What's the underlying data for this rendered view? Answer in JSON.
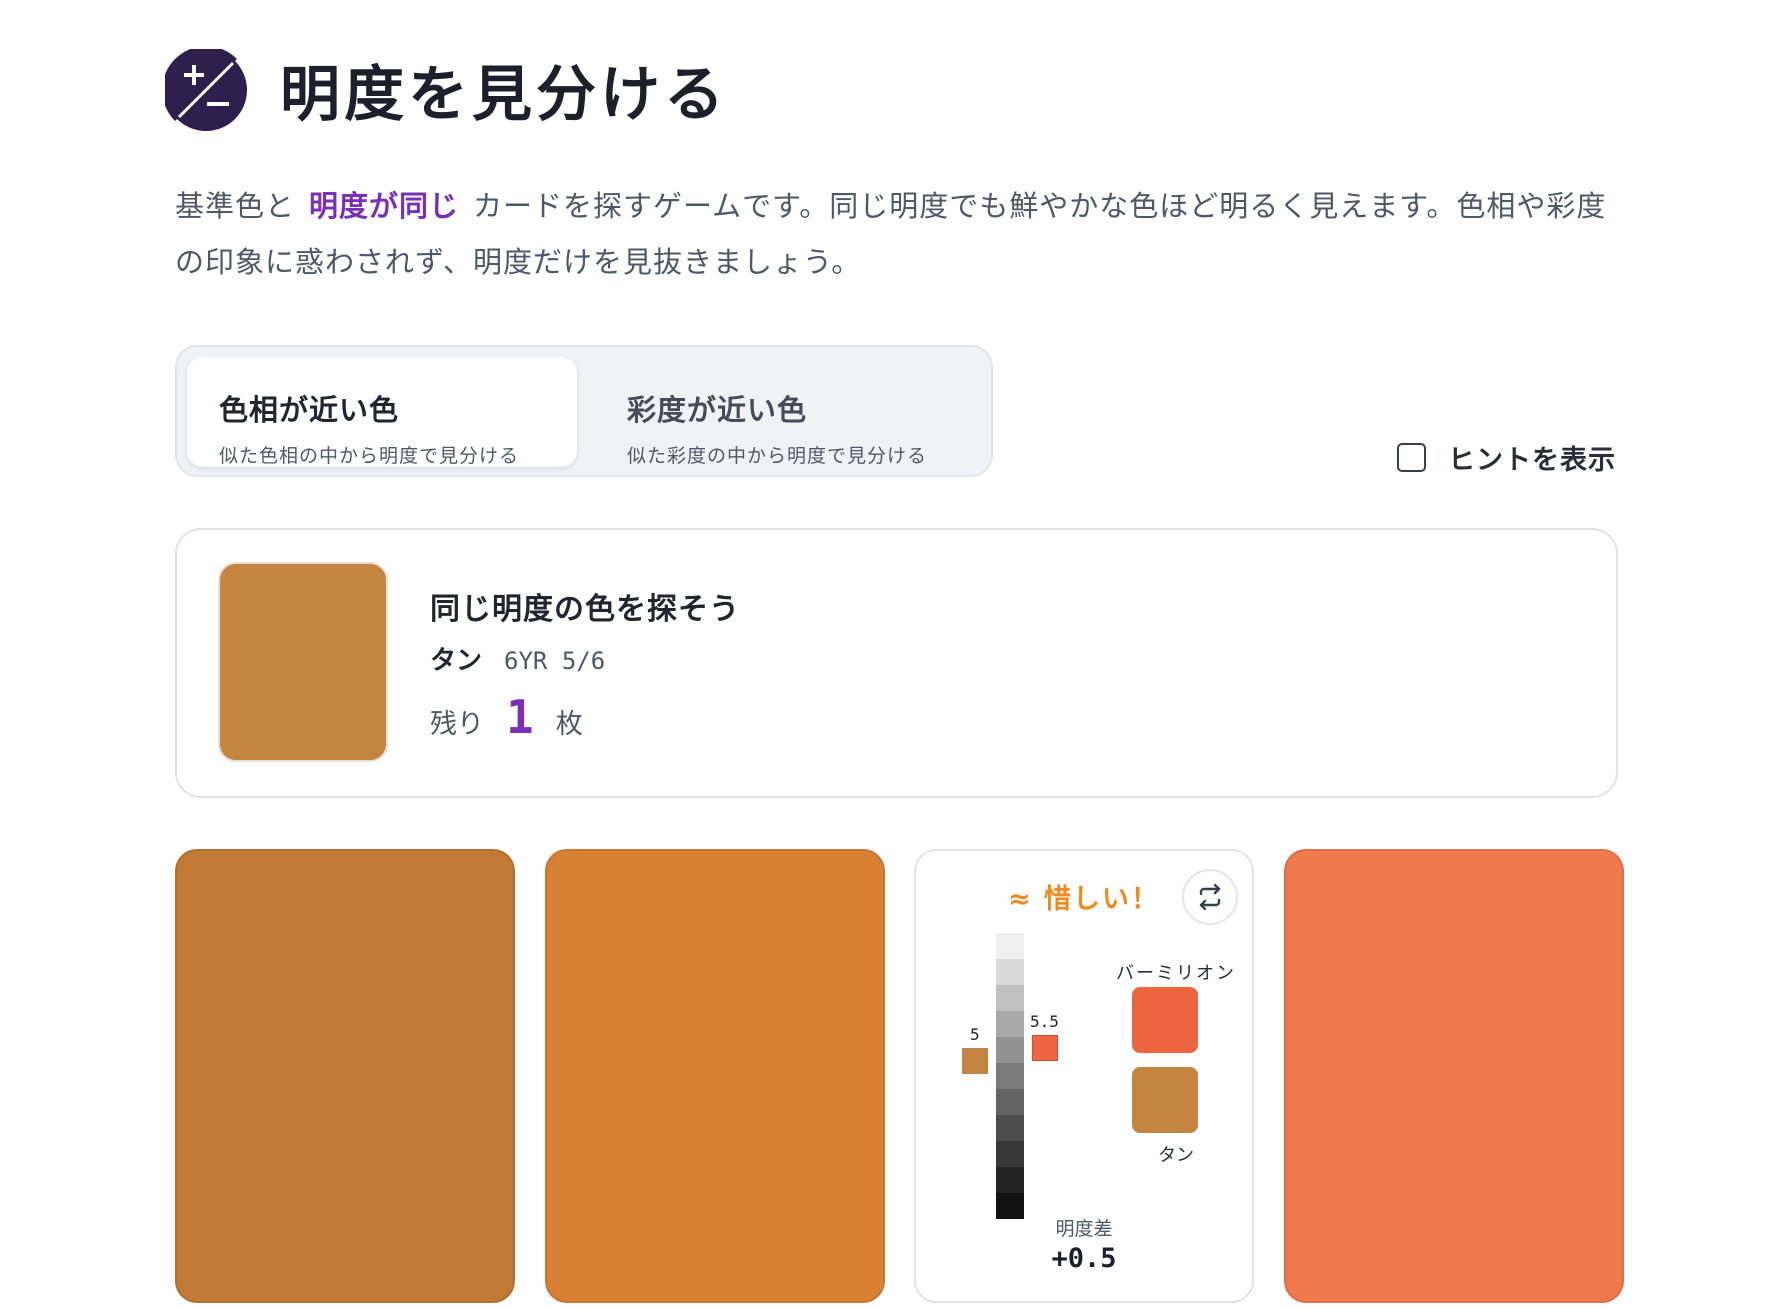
{
  "header": {
    "title": "明度を見分ける",
    "icon": "plus-minus-icon"
  },
  "description": {
    "part1": "基準色と",
    "highlight": "明度が同じ",
    "part2": "カードを探すゲームです。同じ明度でも鮮やかな色ほど明るく見えます。色相や彩度の印象に惑わされず、明度だけを見抜きましょう。"
  },
  "modes": [
    {
      "label": "色相が近い色",
      "sub": "似た色相の中から明度で見分ける",
      "active": true
    },
    {
      "label": "彩度が近い色",
      "sub": "似た彩度の中から明度で見分ける",
      "active": false
    }
  ],
  "hint": {
    "label": "ヒントを表示",
    "checked": false
  },
  "target": {
    "title": "同じ明度の色を探そう",
    "name": "タン",
    "code": "6YR 5/6",
    "remaining_prefix": "残り",
    "remaining_count": "1",
    "remaining_suffix": "枚",
    "color": "#c48540"
  },
  "cards": [
    {
      "color": "#c17a35"
    },
    {
      "color": "#d88033"
    },
    {
      "result": true
    },
    {
      "color": "#ef7a4d"
    }
  ],
  "result": {
    "status": "≈ 惜しい！",
    "left_value": "5",
    "right_value": "5.5",
    "compare_name": "バーミリオン",
    "compare_color": "#ec6540",
    "target_name": "タン",
    "target_color": "#c48540",
    "diff_label": "明度差",
    "diff_value": "+0.5",
    "scale_colors": [
      "#f0f0f0",
      "#d8d8d8",
      "#c0c0c0",
      "#a9a9a9",
      "#929292",
      "#7b7b7b",
      "#646464",
      "#4d4d4d",
      "#373737",
      "#222222",
      "#111111"
    ]
  },
  "colors": {
    "accent": "#7a2fb8",
    "status": "#f08a1c"
  }
}
